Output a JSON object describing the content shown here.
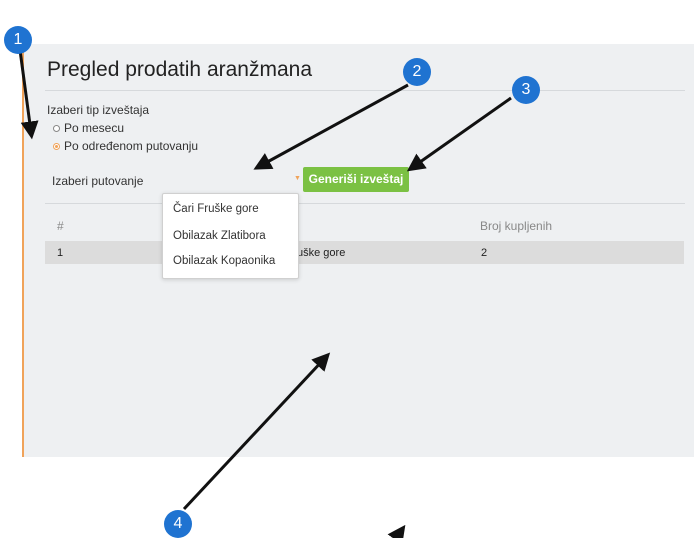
{
  "page": {
    "title": "Pregled prodatih aranžmana"
  },
  "report_type": {
    "label": "Izaberi tip izveštaja",
    "options": [
      "Po mesecu",
      "Po određenom putovanju"
    ],
    "selected": "Po određenom putovanju"
  },
  "trip_select": {
    "label": "Izaberi putovanje",
    "options": [
      "Čari Fruške gore",
      "Obilazak Zlatibora",
      "Obilazak Kopaonika"
    ]
  },
  "generate_button": {
    "label": "Generiši izveštaj"
  },
  "table": {
    "headers": [
      "#",
      "",
      "Broj kupljenih"
    ],
    "rows": [
      {
        "index": "1",
        "name": "uške gore",
        "count": "2"
      }
    ]
  },
  "annotations": {
    "badges": [
      "1",
      "2",
      "3",
      "4"
    ]
  },
  "colors": {
    "accent": "#f0a35a",
    "button": "#7bc143",
    "badge": "#1f73d1",
    "panel": "#eef0f2"
  }
}
